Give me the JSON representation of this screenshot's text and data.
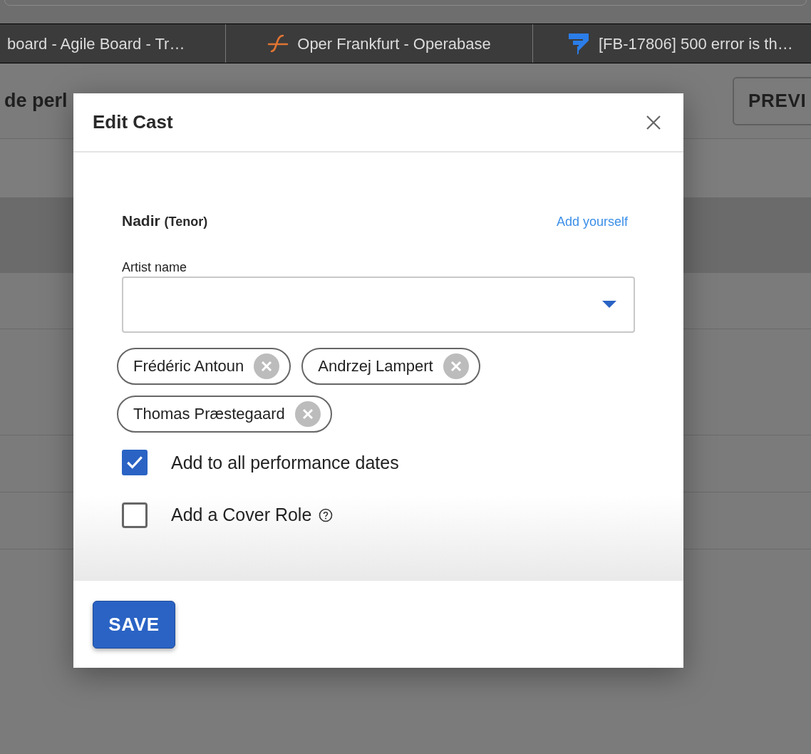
{
  "browser_tabs": [
    {
      "title": "board - Agile Board - Tr…"
    },
    {
      "title": "Oper Frankfurt - Operabase"
    },
    {
      "title": "[FB-17806] 500 error is th…"
    }
  ],
  "page": {
    "title": "de perl",
    "preview_button": "PREVI"
  },
  "dialog": {
    "title": "Edit Cast",
    "role": {
      "name": "Nadir",
      "voice": "(Tenor)"
    },
    "add_yourself": "Add yourself",
    "artist_field": {
      "label": "Artist name"
    },
    "artists": [
      {
        "name": "Frédéric Antoun"
      },
      {
        "name": "Andrzej Lampert"
      },
      {
        "name": "Thomas Præstegaard"
      }
    ],
    "options": [
      {
        "label": "Add to all performance dates",
        "checked": true,
        "help": false
      },
      {
        "label": "Add a Cover Role",
        "checked": false,
        "help": true
      }
    ],
    "save_button": "SAVE"
  }
}
